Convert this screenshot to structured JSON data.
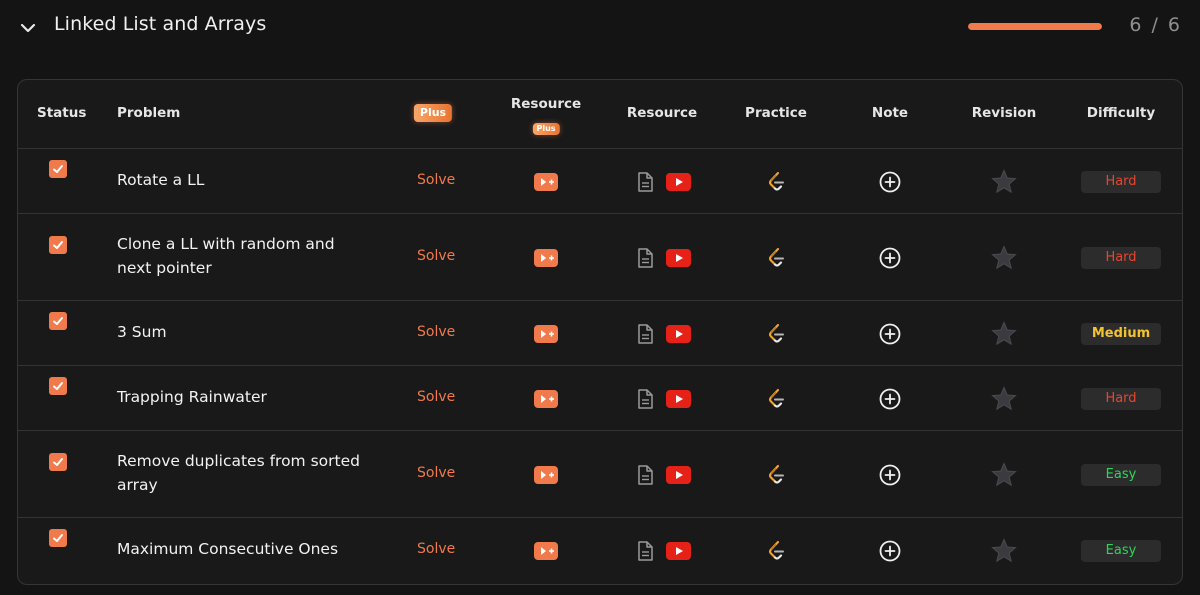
{
  "section": {
    "title": "Linked List and Arrays",
    "progress_text": "6 / 6",
    "progress_fraction": 1.0,
    "accent_color": "#f07a4b"
  },
  "table": {
    "headers": {
      "status": "Status",
      "problem": "Problem",
      "plus": "Plus",
      "resource_plus": "Resource",
      "resource_plus_badge": "Plus",
      "resource": "Resource",
      "practice": "Practice",
      "note": "Note",
      "revision": "Revision",
      "difficulty": "Difficulty"
    },
    "rows": [
      {
        "checked": true,
        "problem": "Rotate a LL",
        "action": "Solve",
        "difficulty": "Hard"
      },
      {
        "checked": true,
        "problem": "Clone a LL with random and next pointer",
        "action": "Solve",
        "difficulty": "Hard"
      },
      {
        "checked": true,
        "problem": "3 Sum",
        "action": "Solve",
        "difficulty": "Medium"
      },
      {
        "checked": true,
        "problem": "Trapping Rainwater",
        "action": "Solve",
        "difficulty": "Hard"
      },
      {
        "checked": true,
        "problem": "Remove duplicates from sorted array",
        "action": "Solve",
        "difficulty": "Easy"
      },
      {
        "checked": true,
        "problem": "Maximum Consecutive Ones",
        "action": "Solve",
        "difficulty": "Easy"
      }
    ]
  },
  "colors": {
    "hard": "#e8452f",
    "medium": "#f2c230",
    "easy": "#2fd35a",
    "youtube": "#e62117"
  },
  "icons": {
    "toggle": "chevron-down-icon",
    "check": "checkmark-icon",
    "video_plus": "video-plus-icon",
    "article": "article-icon",
    "youtube": "youtube-icon",
    "practice": "leetcode-icon",
    "note": "add-note-icon",
    "revision": "star-icon"
  }
}
